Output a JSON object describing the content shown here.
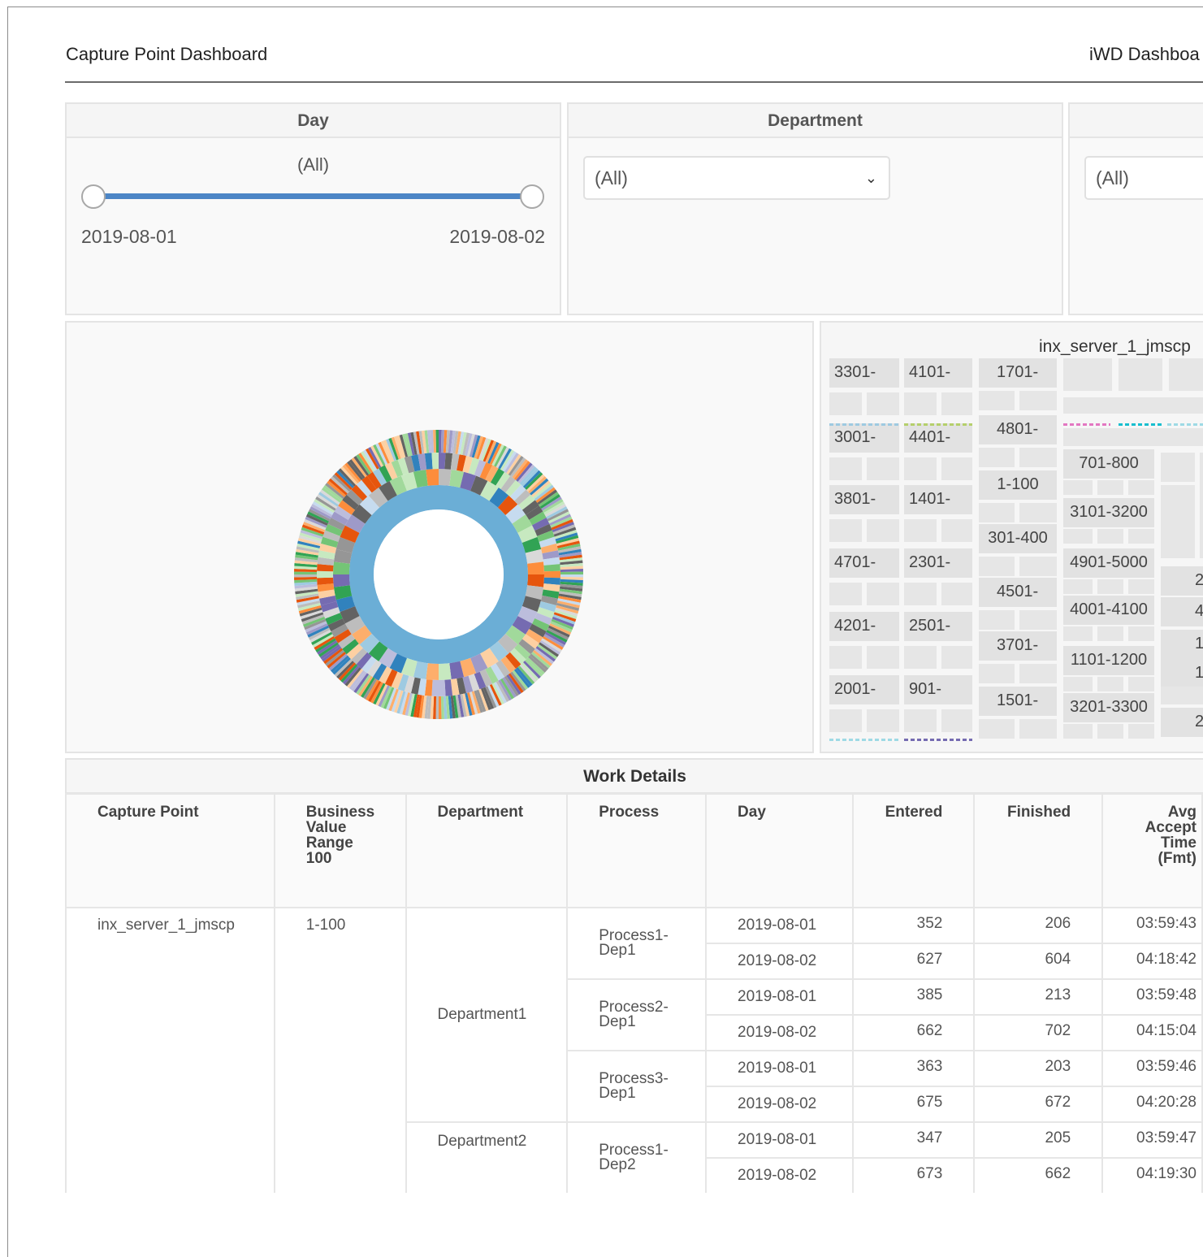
{
  "header": {
    "title": "Capture Point Dashboard",
    "nav_link": "iWD Dashboa"
  },
  "filters": {
    "day": {
      "label": "Day",
      "value": "(All)",
      "min": "2019-08-01",
      "max": "2019-08-02"
    },
    "department": {
      "label": "Department",
      "value": "(All)"
    },
    "third": {
      "label": "",
      "value": "(All)"
    }
  },
  "treemap": {
    "title": "inx_server_1_jmscp",
    "cells_col1": [
      "3301-",
      "3001-",
      "3801-",
      "4701-",
      "4201-",
      "2001-"
    ],
    "cells_col2": [
      "4101-",
      "4401-",
      "1401-",
      "2301-",
      "2501-",
      "901-"
    ],
    "cells_col3": [
      "1701-",
      "4801-",
      "1-100",
      "301-400",
      "4501-",
      "3701-",
      "1501-"
    ],
    "cells_col4": [
      "701-800",
      "3101-3200",
      "4901-5000",
      "4001-4100",
      "1101-1200",
      "3201-3300"
    ],
    "cells_col5": [
      "2",
      "4",
      "1",
      "1",
      "2"
    ]
  },
  "work_details": {
    "title": "Work Details",
    "columns": [
      "Capture Point",
      "Business Value Range 100",
      "Department",
      "Process",
      "Day",
      "Entered",
      "Finished",
      "Avg Accept Time (Fmt)"
    ],
    "capture_point": "inx_server_1_jmscp",
    "business_value": "1-100",
    "departments": [
      "Department1",
      "Department2"
    ],
    "processes": [
      "Process1-Dep1",
      "Process2-Dep1",
      "Process3-Dep1",
      "Process1-Dep2"
    ],
    "rows": [
      {
        "day": "2019-08-01",
        "entered": "352",
        "finished": "206",
        "avg": "03:59:43"
      },
      {
        "day": "2019-08-02",
        "entered": "627",
        "finished": "604",
        "avg": "04:18:42"
      },
      {
        "day": "2019-08-01",
        "entered": "385",
        "finished": "213",
        "avg": "03:59:48"
      },
      {
        "day": "2019-08-02",
        "entered": "662",
        "finished": "702",
        "avg": "04:15:04"
      },
      {
        "day": "2019-08-01",
        "entered": "363",
        "finished": "203",
        "avg": "03:59:46"
      },
      {
        "day": "2019-08-02",
        "entered": "675",
        "finished": "672",
        "avg": "04:20:28"
      },
      {
        "day": "2019-08-01",
        "entered": "347",
        "finished": "205",
        "avg": "03:59:47"
      },
      {
        "day": "2019-08-02",
        "entered": "673",
        "finished": "662",
        "avg": "04:19:30"
      }
    ]
  },
  "colors": {
    "accent": "#4c86c6",
    "sunburst_inner": "#6baed6",
    "sunburst_palette": [
      "#fdd0a2",
      "#e6550d",
      "#756bb1",
      "#9ecae1",
      "#636363",
      "#31a354",
      "#969696",
      "#c7e9c0",
      "#bdbdbd",
      "#3182bd",
      "#a1d99b",
      "#fd8d3c",
      "#bcbddc",
      "#74c476",
      "#d9d9d9",
      "#c6dbef",
      "#9e9ac8",
      "#fdae6b"
    ]
  }
}
